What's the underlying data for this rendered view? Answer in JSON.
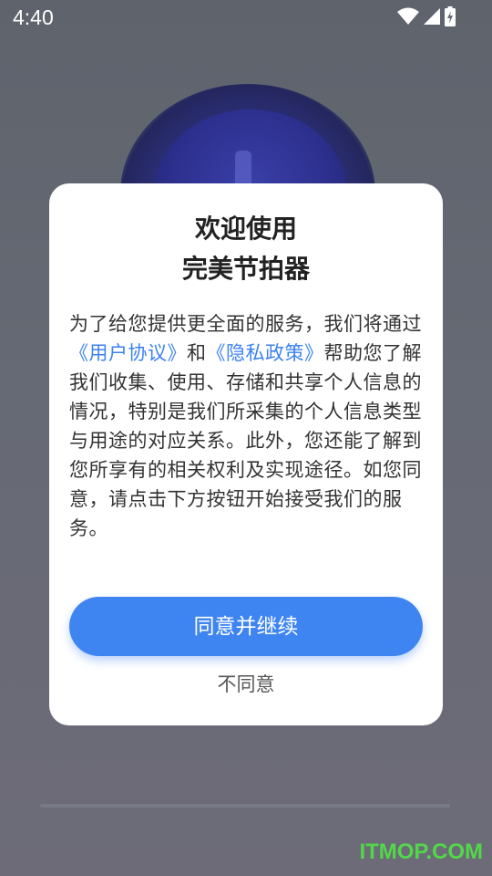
{
  "status_bar": {
    "time": "4:40",
    "icons": [
      "wifi-icon",
      "cellular-signal-icon",
      "battery-charging-icon"
    ]
  },
  "dialog": {
    "title_line1": "欢迎使用",
    "title_line2": "完美节拍器",
    "body": {
      "part1": "为了给您提供更全面的服务，我们将通过",
      "link_user_agreement": "《用户协议》",
      "and_text": "和",
      "link_privacy_policy": "《隐私政策》",
      "part2": "帮助您了解我们收集、使用、存储和共享个人信息的情况，特别是我们所采集的个人信息类型与用途的对应关系。此外，您还能了解到您所享有的相关权利及实现途径。如您同意，请点击下方按钮开始接受我们的服务。"
    },
    "agree_label": "同意并继续",
    "disagree_label": "不同意"
  },
  "watermark": "ITMOP.COM",
  "colors": {
    "accent": "#3f85f2",
    "link": "#3c82f0",
    "watermark": "#52d74a"
  }
}
